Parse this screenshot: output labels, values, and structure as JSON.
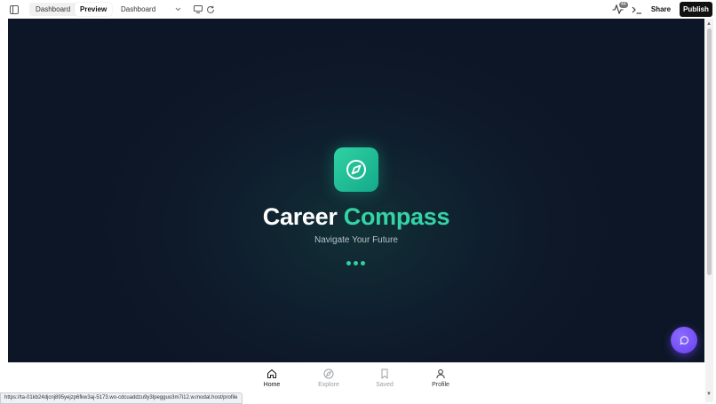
{
  "toolbar": {
    "tab_dashboard": "Dashboard",
    "tab_preview": "Preview",
    "page_select_value": "Dashboard",
    "activity_count": "44",
    "share_label": "Share",
    "publish_label": "Publish"
  },
  "app": {
    "title_part1": "Career",
    "title_part2": "Compass",
    "subtitle": "Navigate Your Future",
    "accent_color": "#34d3a6",
    "fab_color": "#6a3ef0"
  },
  "bottom_nav": [
    {
      "label": "Home",
      "icon": "home-icon",
      "active": true
    },
    {
      "label": "Explore",
      "icon": "compass-icon",
      "active": false
    },
    {
      "label": "Saved",
      "icon": "bookmark-icon",
      "active": false
    },
    {
      "label": "Profile",
      "icon": "user-icon",
      "active": false
    }
  ],
  "status_url": "https://ta-01kb24djcnj895yejzp6fkw3aj-5173.wo-cdcuaddzu9y3lpegguo3m7i12.w.modal.host/profile"
}
